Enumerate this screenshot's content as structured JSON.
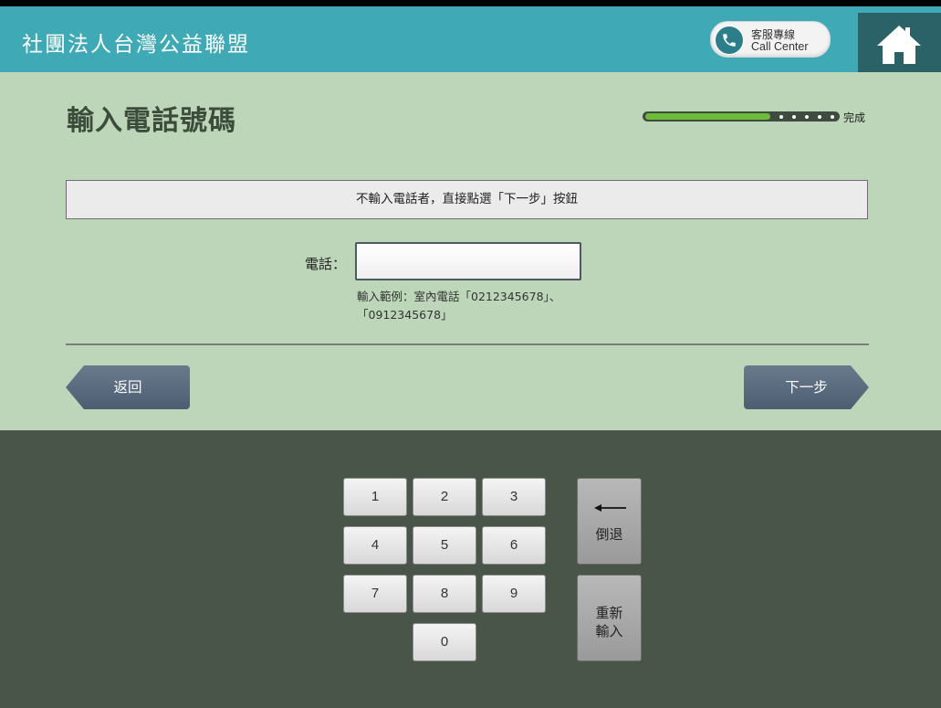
{
  "header": {
    "org_title": "社團法人台灣公益聯盟",
    "call_center_line1": "客服專線",
    "call_center_line2": "Call Center",
    "home_icon": "home-icon",
    "phone_icon": "phone-icon"
  },
  "page": {
    "title": "輸入電話號碼",
    "progress_label": "完成",
    "progress_fraction": 0.65,
    "notice": "不輸入電話者，直接點選「下一步」按鈕",
    "phone_label": "電話：",
    "phone_value": "",
    "hint_line1": "輸入範例：室內電話「0212345678」、",
    "hint_line2": "「0912345678」",
    "back_label": "返回",
    "next_label": "下一步"
  },
  "keypad": {
    "keys": [
      "1",
      "2",
      "3",
      "4",
      "5",
      "6",
      "7",
      "8",
      "9",
      "0"
    ],
    "backspace_label": "倒退",
    "reset_line1": "重新",
    "reset_line2": "輸入"
  },
  "colors": {
    "header": "#3fa9b5",
    "main_bg": "#bdd6b9",
    "keypad_bg": "#4a554a",
    "progress_fill": "#6dbd3a",
    "nav_button": "#5a6a7e"
  }
}
